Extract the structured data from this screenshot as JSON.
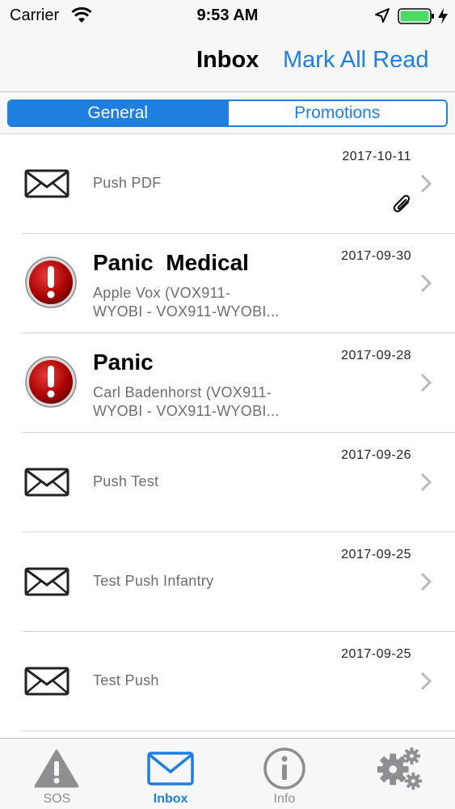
{
  "status_bar": {
    "carrier": "Carrier",
    "time": "9:53 AM"
  },
  "nav": {
    "title": "Inbox",
    "mark_all_read": "Mark All Read"
  },
  "segments": {
    "general": "General",
    "promotions": "Promotions",
    "selected": "General"
  },
  "messages": [
    {
      "icon": "envelope-icon",
      "date": "2017-10-11",
      "title": "",
      "subtitle_line1": "Push PDF",
      "subtitle_line2": "",
      "attachment": true
    },
    {
      "icon": "alert-icon",
      "date": "2017-09-30",
      "title": "Panic  Medical",
      "subtitle_line1": "Apple Vox (VOX911-",
      "subtitle_line2": "WYOBI - VOX911-WYOBI...",
      "attachment": false
    },
    {
      "icon": "alert-icon",
      "date": "2017-09-28",
      "title": "Panic",
      "subtitle_line1": "Carl Badenhorst (VOX911-",
      "subtitle_line2": "WYOBI - VOX911-WYOBI...",
      "attachment": false
    },
    {
      "icon": "envelope-icon",
      "date": "2017-09-26",
      "title": "",
      "subtitle_line1": "Push Test",
      "subtitle_line2": "",
      "attachment": false
    },
    {
      "icon": "envelope-icon",
      "date": "2017-09-25",
      "title": "",
      "subtitle_line1": "Test Push Infantry",
      "subtitle_line2": "",
      "attachment": false
    },
    {
      "icon": "envelope-icon",
      "date": "2017-09-25",
      "title": "",
      "subtitle_line1": "Test Push",
      "subtitle_line2": "",
      "attachment": false
    }
  ],
  "tabs": [
    {
      "label": "SOS",
      "icon": "warning-icon",
      "active": false
    },
    {
      "label": "Inbox",
      "icon": "mail-icon",
      "active": true
    },
    {
      "label": "Info",
      "icon": "info-icon",
      "active": false
    },
    {
      "label": "",
      "icon": "gears-icon",
      "active": false
    }
  ],
  "colors": {
    "accent": "#1f7fe0",
    "battery": "#4cd964",
    "alert_red": "#c40d0d"
  }
}
